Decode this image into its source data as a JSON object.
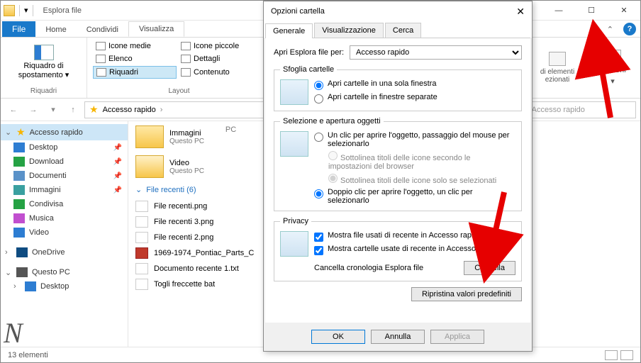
{
  "window": {
    "title": "Esplora file",
    "file_tab": "File",
    "tabs": [
      "Home",
      "Condividi",
      "Visualizza"
    ],
    "active_tab": "Visualizza"
  },
  "win_controls": {
    "min": "—",
    "max": "☐",
    "close": "✕"
  },
  "ribbon": {
    "riquadri": {
      "label": "Riquadri",
      "btn": "Riquadro di spostamento ▾"
    },
    "layout": {
      "label": "Layout",
      "items": [
        "Icone medie",
        "Icone piccole",
        "Elenco",
        "Dettagli",
        "Riquadri",
        "Contenuto"
      ],
      "selected": "Riquadri"
    },
    "right": {
      "elementi": "di elementi\nezionati",
      "opzioni": "Opzioni"
    }
  },
  "nav": {
    "back": "←",
    "fwd": "→",
    "up": "↑",
    "crumb": "Accesso rapido",
    "search_ph": "ca in Accesso rapido"
  },
  "sidebar": {
    "quick": "Accesso rapido",
    "items": [
      {
        "label": "Desktop",
        "pin": true,
        "cls": "desk"
      },
      {
        "label": "Download",
        "pin": true,
        "cls": "dl"
      },
      {
        "label": "Documenti",
        "pin": true,
        "cls": "doc"
      },
      {
        "label": "Immagini",
        "pin": true,
        "cls": "img"
      },
      {
        "label": "Condivisa",
        "pin": false,
        "cls": "share"
      },
      {
        "label": "Musica",
        "pin": false,
        "cls": "mus"
      },
      {
        "label": "Video",
        "pin": false,
        "cls": "vid"
      }
    ],
    "onedrive": "OneDrive",
    "thispc": "Questo PC",
    "desktop2": "Desktop"
  },
  "content": {
    "folders": [
      {
        "name": "Immagini",
        "loc": "Questo PC"
      },
      {
        "name": "Video",
        "loc": "Questo PC"
      }
    ],
    "pc_badge": "PC",
    "recent_header": "File recenti (6)",
    "files": [
      {
        "name": "File recenti.png",
        "type": "img"
      },
      {
        "name": "File recenti 3.png",
        "type": "img"
      },
      {
        "name": "File recenti 2.png",
        "type": "img"
      },
      {
        "name": "1969-1974_Pontiac_Parts_C",
        "type": "pdf"
      },
      {
        "name": "Documento recente 1.txt",
        "type": "txt"
      },
      {
        "name": "Togli freccette bat",
        "type": "bat"
      }
    ]
  },
  "statusbar": {
    "text": "13 elementi"
  },
  "dialog": {
    "title": "Opzioni cartella",
    "tabs": [
      "Generale",
      "Visualizzazione",
      "Cerca"
    ],
    "open_label": "Apri Esplora file per:",
    "open_value": "Accesso rapido",
    "browse": {
      "legend": "Sfoglia cartelle",
      "opt1": "Apri cartelle in una sola finestra",
      "opt2": "Apri cartelle in finestre separate"
    },
    "click": {
      "legend": "Selezione e apertura oggetti",
      "opt1": "Un clic per aprire l'oggetto, passaggio del mouse per selezionarlo",
      "sub1": "Sottolinea titoli delle icone secondo le impostazioni del browser",
      "sub2": "Sottolinea titoli delle icone solo se selezionati",
      "opt2": "Doppio clic per aprire l'oggetto, un clic per selezionarlo"
    },
    "privacy": {
      "legend": "Privacy",
      "chk1": "Mostra file usati di recente in Accesso rapido",
      "chk2": "Mostra cartelle usate di recente in Accesso rapido",
      "clear_label": "Cancella cronologia Esplora file",
      "clear_btn": "Cancella"
    },
    "restore": "Ripristina valori predefiniti",
    "ok": "OK",
    "cancel": "Annulla",
    "apply": "Applica"
  }
}
